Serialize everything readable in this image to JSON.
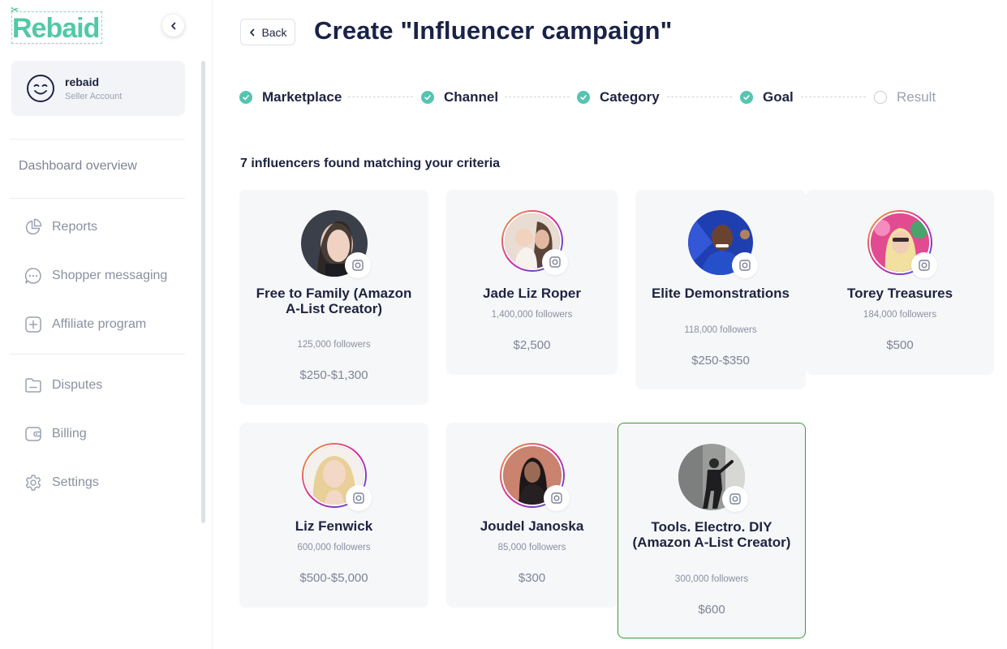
{
  "app": {
    "logo_text": "Rebaid"
  },
  "account": {
    "name": "rebaid",
    "role": "Seller Account"
  },
  "sidebar": {
    "dashboard_label": "Dashboard overview",
    "items": [
      {
        "label": "Reports",
        "icon": "pie-chart-icon"
      },
      {
        "label": "Shopper messaging",
        "icon": "chat-icon"
      },
      {
        "label": "Affiliate program",
        "icon": "plus-square-icon"
      },
      {
        "label": "Disputes",
        "icon": "folder-icon"
      },
      {
        "label": "Billing",
        "icon": "wallet-icon"
      },
      {
        "label": "Settings",
        "icon": "gear-icon"
      }
    ]
  },
  "header": {
    "back_label": "Back",
    "title": "Create \"Influencer campaign\""
  },
  "stepper": {
    "steps": [
      {
        "label": "Marketplace",
        "done": true
      },
      {
        "label": "Channel",
        "done": true
      },
      {
        "label": "Category",
        "done": true
      },
      {
        "label": "Goal",
        "done": true
      },
      {
        "label": "Result",
        "done": false
      }
    ]
  },
  "results": {
    "title": "7 influencers found matching your criteria",
    "influencers": [
      {
        "name": "Free to Family (Amazon A-List Creator)",
        "followers": "125,000 followers",
        "price": "$250-$1,300",
        "platform": "instagram-icon",
        "selected": false
      },
      {
        "name": "Jade Liz Roper",
        "followers": "1,400,000 followers",
        "price": "$2,500",
        "platform": "instagram-icon",
        "selected": false
      },
      {
        "name": "Elite Demonstrations",
        "followers": "118,000 followers",
        "price": "$250-$350",
        "platform": "instagram-icon",
        "selected": false
      },
      {
        "name": "Torey Treasures",
        "followers": "184,000 followers",
        "price": "$500",
        "platform": "instagram-icon",
        "selected": false
      },
      {
        "name": "Liz Fenwick",
        "followers": "600,000 followers",
        "price": "$500-$5,000",
        "platform": "instagram-icon",
        "selected": false
      },
      {
        "name": "Joudel Janoska",
        "followers": "85,000 followers",
        "price": "$300",
        "platform": "instagram-icon",
        "selected": false
      },
      {
        "name": "Tools. Electro. DIY (Amazon A-List Creator)",
        "followers": "300,000 followers",
        "price": "$600",
        "platform": "instagram-icon",
        "selected": true
      }
    ]
  },
  "colors": {
    "brand": "#52c9a6",
    "step_done": "#56c4b0",
    "selected_border": "#3d9b3a",
    "title": "#1a2247"
  }
}
